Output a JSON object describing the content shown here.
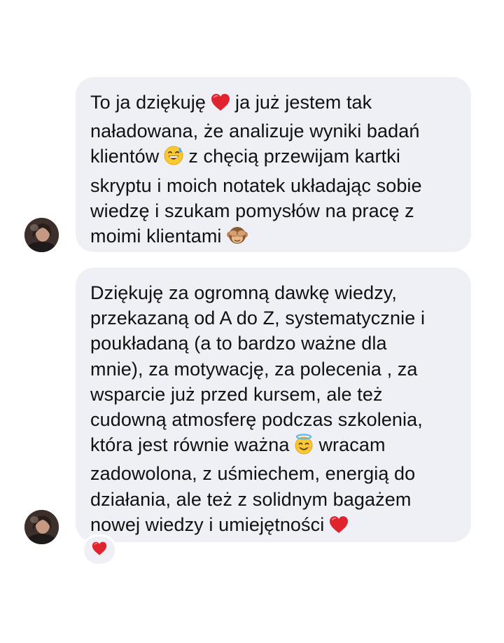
{
  "messages": [
    {
      "lines": [
        [
          "To ja dziękuję",
          "ja już jestem tak"
        ],
        [
          "naładowana, że analizuje wyniki badań"
        ],
        [
          "klientów",
          "z chęcią przewijam kartki"
        ],
        [
          "skryptu i moich notatek układając sobie"
        ],
        [
          "wiedzę i szukam pomysłów na pracę z"
        ],
        [
          "moimi klientami"
        ]
      ],
      "emojis": [
        "heart-emoji-icon",
        "grinning-sweat-emoji-icon",
        "see-no-evil-monkey-emoji-icon"
      ]
    },
    {
      "lines": [
        [
          "Dziękuję za ogromną dawkę wiedzy,"
        ],
        [
          "przekazaną od A do Z, systematycznie i"
        ],
        [
          "poukładaną (a to bardzo ważne dla"
        ],
        [
          "mnie), za motywację, za polecenia , za"
        ],
        [
          "wsparcie już przed kursem, ale też"
        ],
        [
          "cudowną atmosferę podczas szkolenia,"
        ],
        [
          "która jest równie ważna",
          "wracam"
        ],
        [
          "zadowolona, z uśmiechem, energią do"
        ],
        [
          "działania, ale też z solidnym bagażem"
        ],
        [
          "nowej wiedzy i umiejętności"
        ]
      ],
      "emojis": [
        "smiling-halo-emoji-icon",
        "heart-emoji-icon"
      ]
    }
  ],
  "reaction": {
    "icon": "heart-reaction-icon"
  },
  "colors": {
    "bubble": "#eff0f5",
    "text": "#111111",
    "heart": "#e0242f",
    "background": "#ffffff"
  }
}
